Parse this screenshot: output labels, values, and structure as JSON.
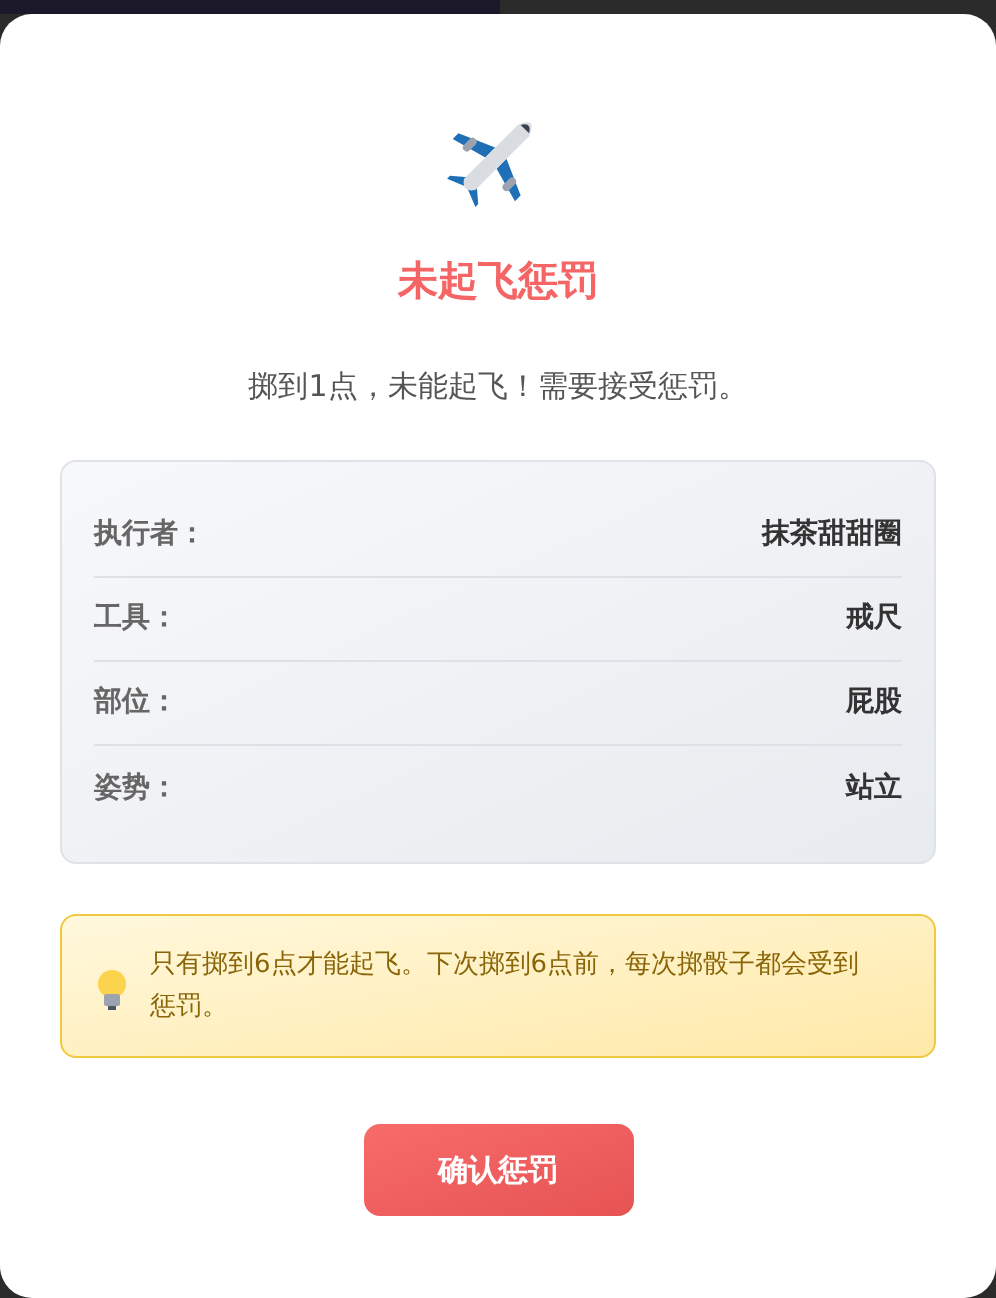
{
  "dialog": {
    "title": "未起飞惩罚",
    "message": "掷到1点，未能起飞！需要接受惩罚。",
    "details": [
      {
        "label": "执行者：",
        "value": "抹茶甜甜圈"
      },
      {
        "label": "工具：",
        "value": "戒尺"
      },
      {
        "label": "部位：",
        "value": "屁股"
      },
      {
        "label": "姿势：",
        "value": "站立"
      }
    ],
    "tip": "只有掷到6点才能起飞。下次掷到6点前，每次掷骰子都会受到惩罚。",
    "button": "确认惩罚"
  }
}
